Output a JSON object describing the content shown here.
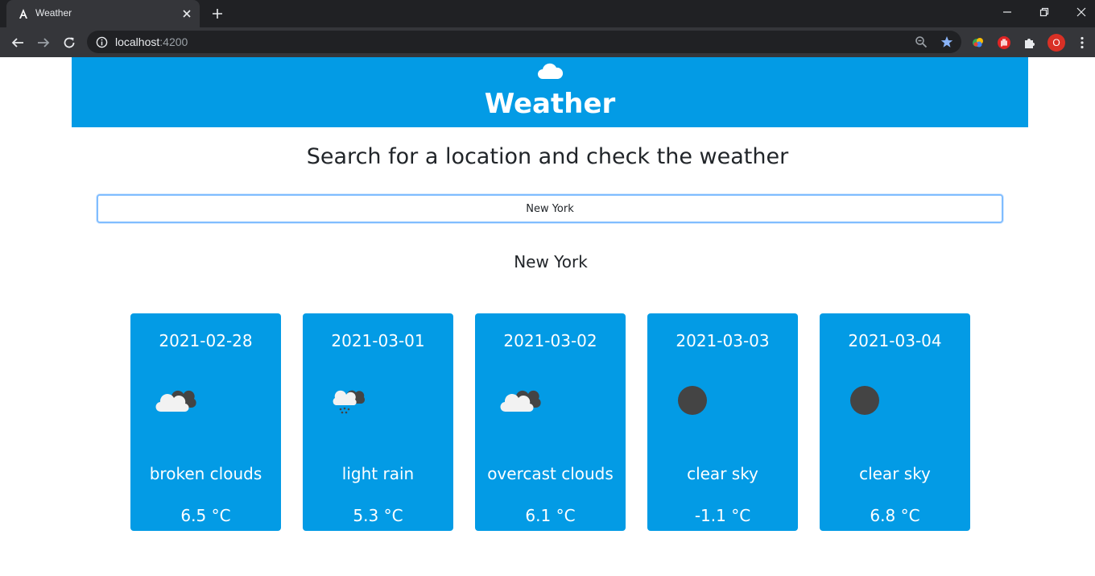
{
  "browser": {
    "tab_title": "Weather",
    "url_host": "localhost",
    "url_port": ":4200",
    "profile_initial": "O"
  },
  "header": {
    "title": "Weather",
    "icon": "cloud-icon"
  },
  "main": {
    "subtitle": "Search for a location and check the weather",
    "search_value": "New York",
    "location_name": "New York"
  },
  "forecast": [
    {
      "date": "2021-02-28",
      "icon": "broken-clouds-icon",
      "description": "broken clouds",
      "temperature": "6.5 °C"
    },
    {
      "date": "2021-03-01",
      "icon": "light-rain-icon",
      "description": "light rain",
      "temperature": "5.3 °C"
    },
    {
      "date": "2021-03-02",
      "icon": "overcast-clouds-icon",
      "description": "overcast clouds",
      "temperature": "6.1 °C"
    },
    {
      "date": "2021-03-03",
      "icon": "clear-sky-icon",
      "description": "clear sky",
      "temperature": "-1.1 °C"
    },
    {
      "date": "2021-03-04",
      "icon": "clear-sky-icon",
      "description": "clear sky",
      "temperature": "6.8 °C"
    }
  ],
  "colors": {
    "brand_blue": "#039be5",
    "focus_border": "#80bdff",
    "text_dark": "#212529"
  }
}
